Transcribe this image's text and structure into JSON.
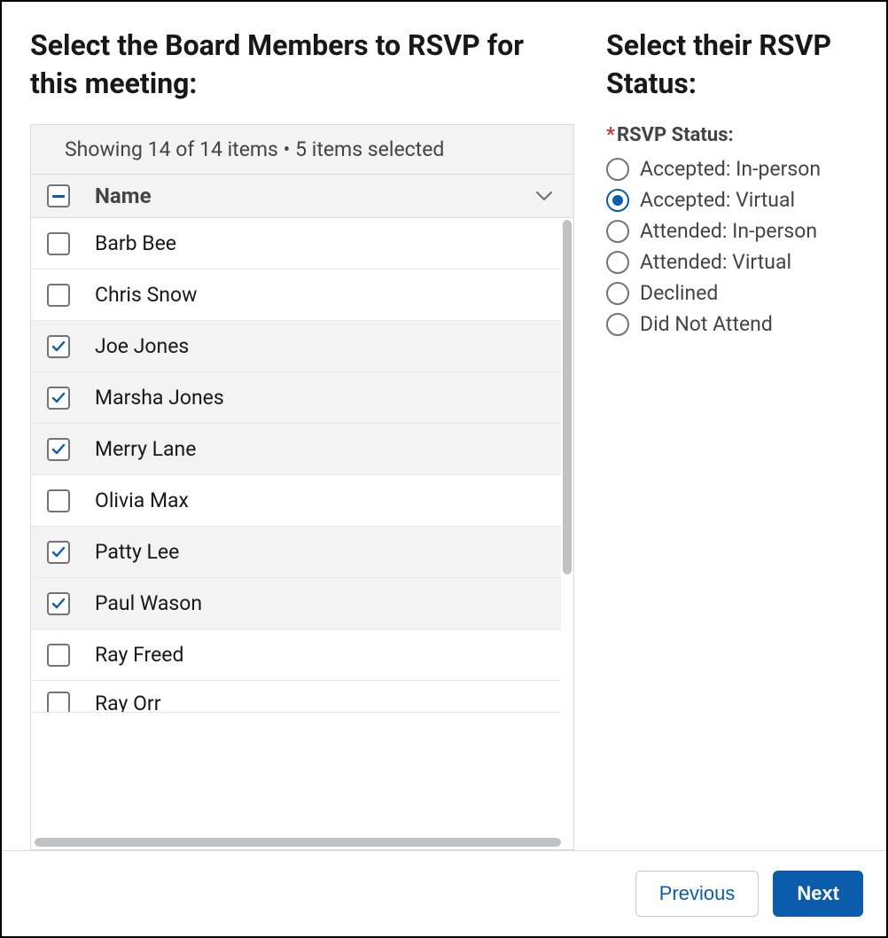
{
  "left": {
    "heading": "Select the Board Members to RSVP for this meeting:",
    "status_text": "Showing 14 of 14 items • 5 items selected",
    "name_col": "Name",
    "select_all_state": "indeterminate",
    "rows": [
      {
        "name": "Barb Bee",
        "selected": false
      },
      {
        "name": "Chris Snow",
        "selected": false
      },
      {
        "name": "Joe Jones",
        "selected": true
      },
      {
        "name": "Marsha Jones",
        "selected": true
      },
      {
        "name": "Merry Lane",
        "selected": true
      },
      {
        "name": "Olivia Max",
        "selected": false
      },
      {
        "name": "Patty Lee",
        "selected": true
      },
      {
        "name": "Paul Wason",
        "selected": true
      },
      {
        "name": "Ray Freed",
        "selected": false
      },
      {
        "name": "Ray Orr",
        "selected": false
      }
    ]
  },
  "right": {
    "heading": "Select their RSVP Status:",
    "field_label": "RSVP Status:",
    "options": [
      {
        "label": "Accepted: In-person",
        "selected": false
      },
      {
        "label": "Accepted: Virtual",
        "selected": true
      },
      {
        "label": "Attended: In-person",
        "selected": false
      },
      {
        "label": "Attended: Virtual",
        "selected": false
      },
      {
        "label": "Declined",
        "selected": false
      },
      {
        "label": "Did Not Attend",
        "selected": false
      }
    ]
  },
  "footer": {
    "previous": "Previous",
    "next": "Next"
  }
}
